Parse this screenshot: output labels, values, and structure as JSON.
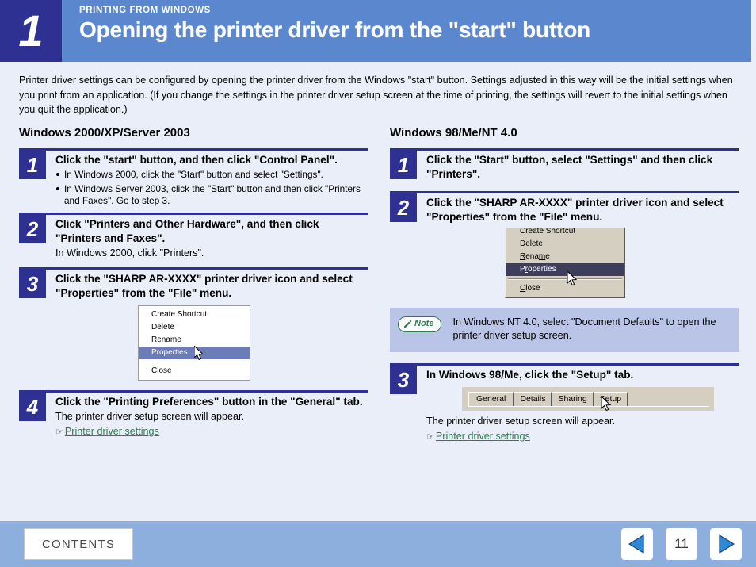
{
  "header": {
    "number": "1",
    "kicker": "PRINTING FROM WINDOWS",
    "title": "Opening the printer driver from the \"start\" button",
    "bg_color": "#5b87cf",
    "num_bg_color": "#2e3192"
  },
  "intro": "Printer driver settings can be configured by opening the printer driver from the Windows \"start\" button. Settings adjusted in this way will be the initial settings when you print from an application. (If you change the settings in the printer driver setup screen at the time of printing, the settings will revert to the initial settings when you quit the application.)",
  "left_column": {
    "title": "Windows 2000/XP/Server 2003",
    "step1": {
      "number": "1",
      "head": "Click the \"start\" button, and then click \"Control Panel\".",
      "bullet1": "In Windows 2000, click the \"Start\" button and select \"Settings\".",
      "bullet2": "In Windows Server 2003, click the \"Start\" button and then click \"Printers and Faxes\". Go to step 3."
    },
    "step2": {
      "number": "2",
      "head": "Click \"Printers and Other Hardware\", and then click \"Printers and Faxes\".",
      "sub": "In Windows 2000, click \"Printers\"."
    },
    "step3": {
      "number": "3",
      "head": "Click the \"SHARP AR-XXXX\" printer driver icon and select \"Properties\" from the \"File\" menu.",
      "menu": {
        "items": [
          "Create Shortcut",
          "Delete",
          "Rename",
          "Properties",
          "Close"
        ],
        "selected": "Properties",
        "highlight_color": "#6b7cb8"
      }
    },
    "step4": {
      "number": "4",
      "head": "Click the \"Printing Preferences\" button in the \"General\" tab.",
      "sub": "The printer driver setup screen will appear.",
      "link": "Printer driver settings"
    }
  },
  "right_column": {
    "title": "Windows 98/Me/NT 4.0",
    "step1": {
      "number": "1",
      "head": "Click the \"Start\" button, select \"Settings\" and then click \"Printers\"."
    },
    "step2": {
      "number": "2",
      "head": "Click the \"SHARP AR-XXXX\" printer driver icon and select \"Properties\" from the \"File\" menu.",
      "menu": {
        "items": [
          "Create Shortcut",
          "Delete",
          "Rename",
          "Properties",
          "Close"
        ],
        "selected": "Properties",
        "highlight_color": "#3d3d5c"
      }
    },
    "note": {
      "badge_label": "Note",
      "text": "In Windows NT 4.0, select \"Document Defaults\" to open the printer driver setup screen.",
      "bg_color": "#b9c4e6",
      "accent_color": "#2f7d4f"
    },
    "step3": {
      "number": "3",
      "head": "In Windows 98/Me, click the \"Setup\" tab.",
      "tabs": [
        "General",
        "Details",
        "Sharing",
        "Setup"
      ],
      "active_tab": "General",
      "sub": "The printer driver setup screen will appear.",
      "link": "Printer driver settings"
    }
  },
  "footer": {
    "contents_label": "CONTENTS",
    "prev_icon": "left-triangle-icon",
    "next_icon": "right-triangle-icon",
    "page_number": "11",
    "bg_color": "#8cafdd"
  },
  "icons": {
    "hand": "☞",
    "pencil": "pencil-icon"
  }
}
